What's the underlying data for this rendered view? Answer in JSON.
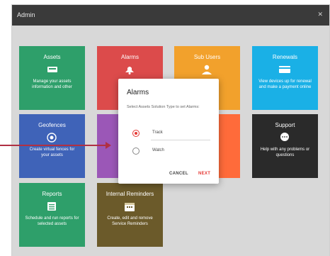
{
  "window": {
    "title": "Admin",
    "close_icon": "close-icon"
  },
  "tiles": [
    {
      "key": "assets",
      "title": "Assets",
      "icon": "truck-icon",
      "color": "#2e9f6a",
      "desc": "Manage your assets information and other"
    },
    {
      "key": "alarms",
      "title": "Alarms",
      "icon": "bell-icon",
      "color": "#dc4b4b",
      "desc": ""
    },
    {
      "key": "subusers",
      "title": "Sub Users",
      "icon": "user-icon",
      "color": "#f2a12c",
      "desc": ""
    },
    {
      "key": "renewals",
      "title": "Renewals",
      "icon": "card-icon",
      "color": "#1ab0e6",
      "desc": "View devices up for renewal and make a payment online"
    },
    {
      "key": "geofences",
      "title": "Geofences",
      "icon": "target-icon",
      "color": "#3f63b8",
      "desc": "Create virtual fences for your assets"
    },
    {
      "key": "tile6",
      "title": "",
      "icon": "",
      "color": "#9b57b7",
      "desc": ""
    },
    {
      "key": "tile7",
      "title": "",
      "icon": "",
      "color": "#ff6b3a",
      "desc": ""
    },
    {
      "key": "support",
      "title": "Support",
      "icon": "chat-icon",
      "color": "#2a2a2a",
      "desc": "Help with any problems or questions"
    },
    {
      "key": "reports",
      "title": "Reports",
      "icon": "report-icon",
      "color": "#2e9f6a",
      "desc": "Schedule and run reports for selected assets"
    },
    {
      "key": "reminders",
      "title": "Internal Reminders",
      "icon": "calendar-icon",
      "color": "#6b5a2a",
      "desc": "Create, edit and remove Service Reminders"
    }
  ],
  "dialog": {
    "title": "Alarms",
    "instruction": "Select Assets Solution Type to set Alarms:",
    "options": [
      {
        "label": "Track",
        "selected": true
      },
      {
        "label": "Watch",
        "selected": false
      }
    ],
    "cancel_label": "CANCEL",
    "next_label": "NEXT"
  },
  "colors": {
    "accent": "#e53935",
    "callout": "#b03043"
  }
}
